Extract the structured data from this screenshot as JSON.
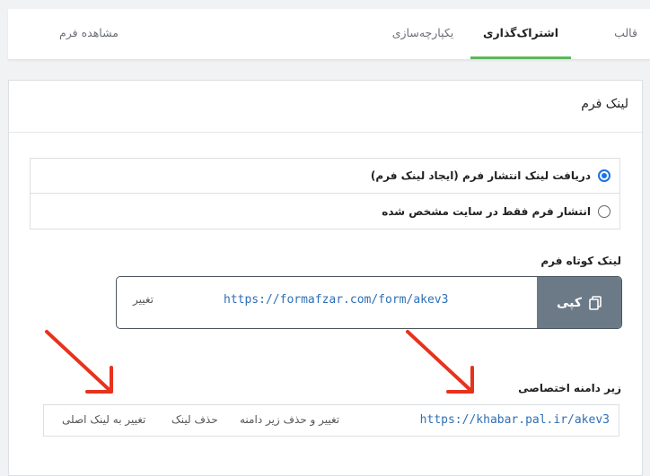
{
  "tabs": [
    {
      "label": "قالب"
    },
    {
      "label": "اشتراک‌گذاری"
    },
    {
      "label": "یکپارچه‌سازی"
    },
    {
      "label": "مشاهده فرم"
    }
  ],
  "card": {
    "title": "لینک فرم",
    "radio_options": [
      {
        "label": "دریافت لینک انتشار فرم (ایجاد لینک فرم)",
        "checked": true
      },
      {
        "label": "انتشار فرم فقط در سایت مشخص شده",
        "checked": false
      }
    ],
    "short_link": {
      "label": "لینک کوتاه فرم",
      "url": "https://formafzar.com/form/akev3",
      "copy_label": "کپی",
      "change_label": "تغییر"
    },
    "subdomain": {
      "label": "زیر دامنه اختصاصی",
      "url": "https://khabar.pal.ir/akev3",
      "actions": [
        "تغییر و حذف زیر دامنه",
        "حذف لینک",
        "تغییر به لینک اصلی"
      ]
    }
  },
  "colors": {
    "accent_green": "#5cb85c",
    "radio_blue": "#1a73e8",
    "link_blue": "#2f6fb5",
    "copy_button": "#6c7a87",
    "arrow_red": "#e8321c"
  },
  "icons": [
    "copy-icon",
    "arrow-annotation"
  ]
}
